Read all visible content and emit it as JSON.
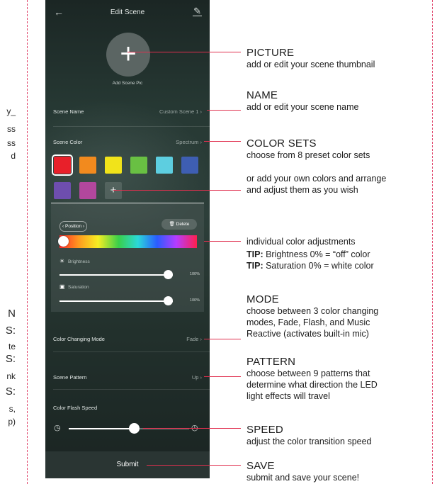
{
  "left_clipped": [
    "y_",
    "ss",
    "ss",
    "d",
    "N",
    "S:",
    "te",
    "S:",
    "nk",
    "S:",
    "s,",
    "p)"
  ],
  "app": {
    "title": "Edit Scene",
    "back_icon": "arrow-left-icon",
    "edit_icon": "pencil-icon",
    "picture_label": "Add Scene Pic",
    "scene_name_label": "Scene Name",
    "scene_name_value": "Custom Scene 1",
    "scene_color_label": "Scene Color",
    "scene_color_value": "Spectrum",
    "swatches": [
      "#e8202a",
      "#f28a1e",
      "#f1e31a",
      "#69c043",
      "#5dcee0",
      "#3e5eb2",
      "#6e4eae",
      "#b2479d"
    ],
    "add_symbol": "+",
    "position_label": "Position",
    "delete_label": "Delete",
    "brightness_label": "Brightness",
    "brightness_value": "100%",
    "brightness_level": 100,
    "saturation_label": "Saturation",
    "saturation_value": "100%",
    "saturation_level": 100,
    "mode_label": "Color Changing Mode",
    "mode_value": "Fade",
    "pattern_label": "Scene Pattern",
    "pattern_value": "Up",
    "speed_label": "Color Flash Speed",
    "speed_level": 0.54,
    "submit_label": "Submit"
  },
  "callouts": {
    "picture": {
      "title": "PICTURE",
      "desc": "add or edit your scene thumbnail"
    },
    "name": {
      "title": "NAME",
      "desc": "add or edit your scene name"
    },
    "color_sets": {
      "title": "COLOR SETS",
      "desc": "choose from 8 preset color sets"
    },
    "add_colors": {
      "line1": "or add your own colors and arrange",
      "line2": "and adjust them as you wish"
    },
    "adjust": {
      "line1": "individual color adjustments",
      "tip_label": "TIP:",
      "tip1": "Brightness 0% = “off” color",
      "tip2": "Saturation 0% = white color"
    },
    "mode": {
      "title": "MODE",
      "line1": "choose between 3 color changing",
      "line2": "modes, Fade, Flash, and Music",
      "line3": "Reactive (activates built-in mic)"
    },
    "pattern": {
      "title": "PATTERN",
      "line1": "choose  between 9 patterns that",
      "line2": "determine what direction the LED",
      "line3": "light effects will travel"
    },
    "speed": {
      "title": "SPEED",
      "desc": "adjust the color transition speed"
    },
    "save": {
      "title": "SAVE",
      "desc": "submit and save your scene!"
    }
  },
  "accent_line_color": "#e0304f"
}
